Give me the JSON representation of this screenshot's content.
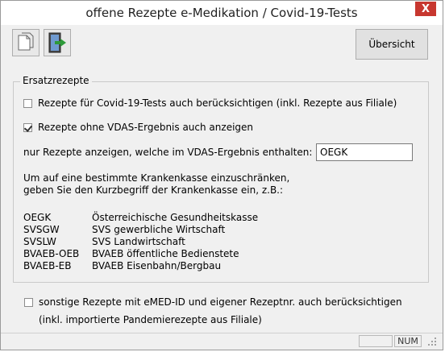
{
  "window": {
    "title": "offene Rezepte e-Medikation / Covid-19-Tests",
    "close_glyph": "X"
  },
  "toolbar": {
    "overview_label": "Übersicht",
    "icons": [
      "copy-icon",
      "exit-icon"
    ]
  },
  "group": {
    "legend": "Ersatzrezepte",
    "covid_checkbox": {
      "label": "Rezepte für Covid-19-Tests auch berücksichtigen (inkl. Rezepte aus Filiale)",
      "checked": false
    },
    "vdas_checkbox": {
      "label": "Rezepte ohne VDAS-Ergebnis auch anzeigen",
      "checked": true
    },
    "filter_label": "nur Rezepte anzeigen, welche im VDAS-Ergebnis enthalten:",
    "filter_value": "OEGK",
    "hint_line1": "Um auf eine bestimmte Krankenkasse einzuschränken,",
    "hint_line2": "geben Sie den Kurzbegriff der Krankenkasse ein, z.B.:",
    "codes": [
      {
        "code": "OEGK",
        "name": "Österreichische Gesundheitskasse"
      },
      {
        "code": "SVSGW",
        "name": "SVS gewerbliche Wirtschaft"
      },
      {
        "code": "SVSLW",
        "name": "SVS Landwirtschaft"
      },
      {
        "code": "BVAEB-OEB",
        "name": "BVAEB öffentliche Bedienstete"
      },
      {
        "code": "BVAEB-EB",
        "name": "BVAEB Eisenbahn/Bergbau"
      }
    ]
  },
  "other_checkbox": {
    "label": "sonstige Rezepte mit eMED-ID und eigener Rezeptnr. auch berücksichtigen",
    "sublabel": "(inkl. importierte Pandemierezepte aus Filiale)",
    "checked": false
  },
  "statusbar": {
    "num": "NUM"
  }
}
